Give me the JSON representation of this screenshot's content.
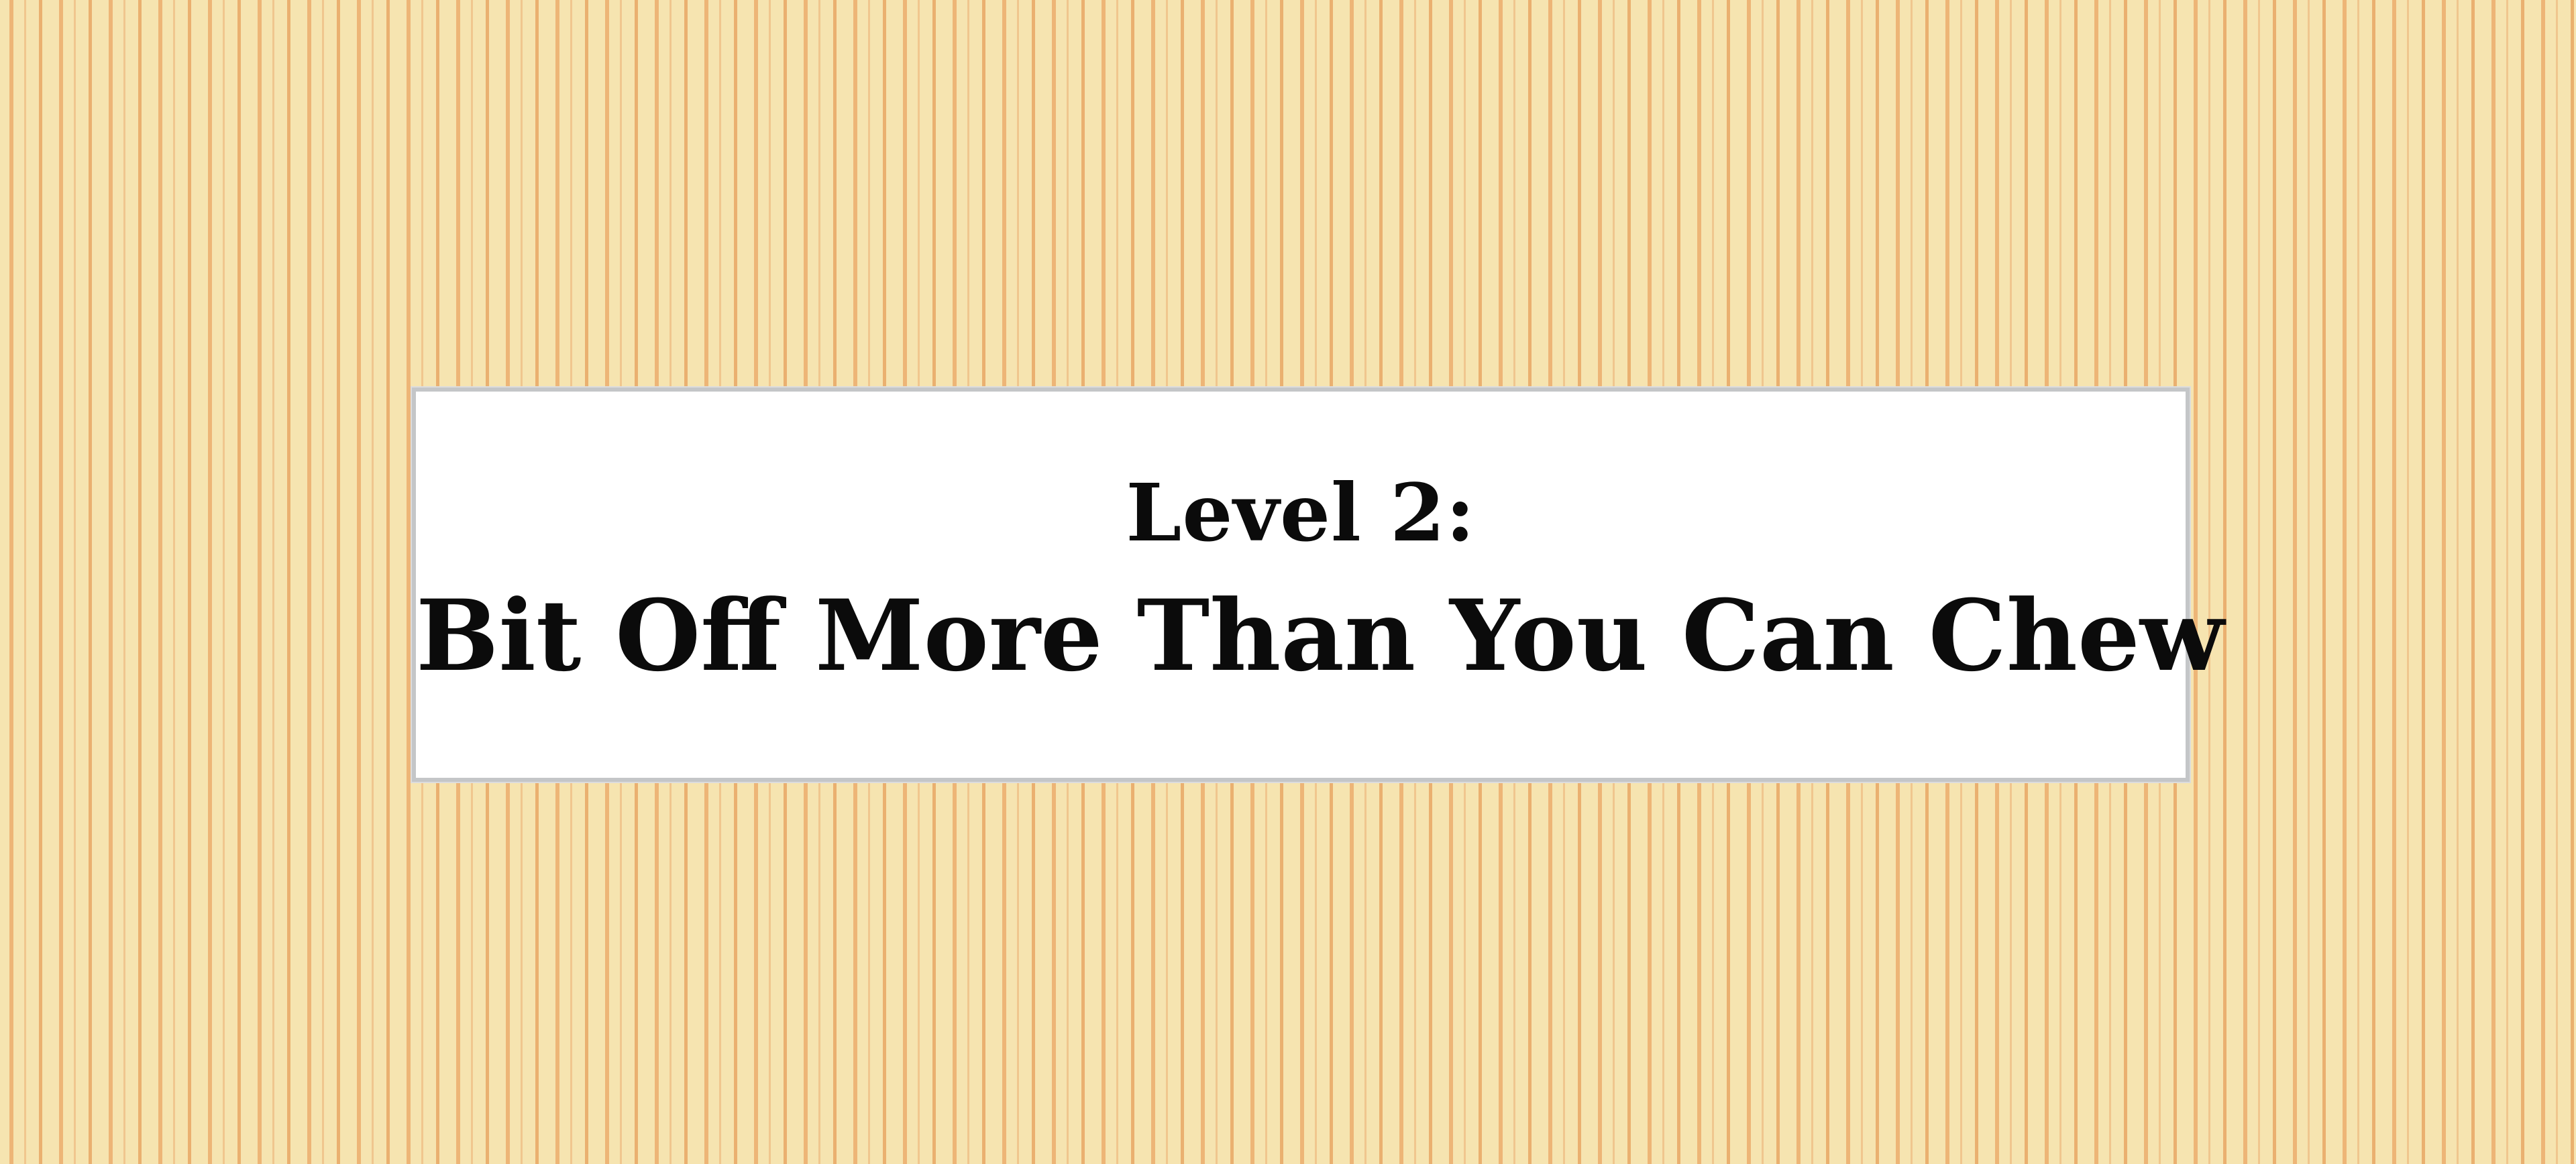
{
  "level": {
    "label": "Level 2:",
    "name": "Bit Off More Than You Can Chew"
  },
  "colors": {
    "background_base": "#f6e4b0",
    "stripe": "#edb577",
    "card_background": "#ffffff",
    "card_border": "#c4c6c8",
    "text": "#0b0b0b"
  }
}
